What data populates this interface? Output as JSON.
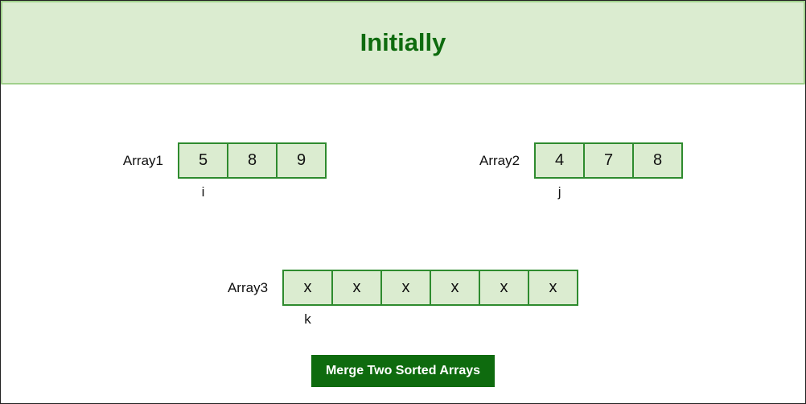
{
  "title": "Initially",
  "array1": {
    "label": "Array1",
    "values": [
      "5",
      "8",
      "9"
    ],
    "pointer": {
      "label": "i",
      "index": 0
    }
  },
  "array2": {
    "label": "Array2",
    "values": [
      "4",
      "7",
      "8"
    ],
    "pointer": {
      "label": "j",
      "index": 0
    }
  },
  "array3": {
    "label": "Array3",
    "values": [
      "x",
      "x",
      "x",
      "x",
      "x",
      "x"
    ],
    "pointer": {
      "label": "k",
      "index": 0
    }
  },
  "button": {
    "label": "Merge Two Sorted Arrays"
  },
  "colors": {
    "accent": "#0e6b0e",
    "cellFill": "#dbecd0",
    "cellBorder": "#2e8b2e"
  }
}
